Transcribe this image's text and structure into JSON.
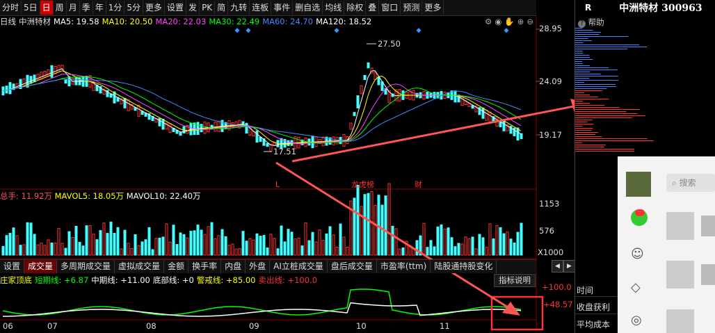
{
  "toolbar": {
    "items": [
      "分时",
      "5日",
      "日",
      "周",
      "月",
      "季",
      "年",
      "1分",
      "5分",
      "更多",
      "设置",
      "发",
      "PK",
      "简",
      "九转",
      "连板",
      "事件",
      "删自选",
      "均线",
      "除权",
      "叠",
      "窗口",
      "预测",
      "更多"
    ],
    "active_index": 2
  },
  "ma_line": {
    "prefix": "日线",
    "stock_name": "中洲特材",
    "ma5": "MA5: 19.58",
    "ma10": "MA10: 20.50",
    "ma20": "MA20: 22.03",
    "ma30": "MA30: 22.49",
    "ma60": "MA60: 24.70",
    "ma120": "MA120: 18.52",
    "colors": {
      "ma5": "#ffffff",
      "ma10": "#ffff00",
      "ma20": "#ff44ff",
      "ma30": "#00ff00",
      "ma60": "#4488ff",
      "ma120": "#ffffff"
    }
  },
  "price_axis": {
    "ticks": [
      "28.95",
      "24.09",
      "19.17"
    ]
  },
  "price_annotations": {
    "high": "27.50",
    "low": "17.51",
    "markers": [
      "L",
      "龙虎榜",
      "财"
    ]
  },
  "volume_line": {
    "vol": "总手: 11.92万",
    "mavol5": "MAVOL5: 18.05万",
    "mavol10": "MAVOL10: 22.40万"
  },
  "volume_axis": {
    "ticks": [
      "1153",
      "576",
      "X1000"
    ]
  },
  "tabs": [
    "设置",
    "成交量",
    "多周期成交量",
    "虚拟成交量",
    "金额",
    "换手率",
    "内盘",
    "外盘",
    "AI立桩成交量",
    "盘后成交量",
    "市盈率(ttm)",
    "陆股通持股变化"
  ],
  "active_tab_index": 1,
  "indicator_line": {
    "name": "庄家顶底",
    "short": "短期线: +6.87",
    "mid": "中期线: +11.00",
    "bottom": "底部线: +0",
    "warn": "警戒线: +85.00",
    "sell": "卖出线: +100.0",
    "help": "指标说明"
  },
  "indicator_axis": {
    "ticks": [
      "+100.0",
      "+48.57"
    ]
  },
  "date_axis": {
    "labels": [
      "06",
      "07",
      "08",
      "09",
      "10",
      "11"
    ]
  },
  "right_panel": {
    "market": "R",
    "stock_title": "中洲特材 300963",
    "help": "帮助",
    "info_labels": [
      "时间",
      "收盘获利",
      "平均成本"
    ]
  },
  "social_panel": {
    "search_placeholder": "搜索"
  }
}
